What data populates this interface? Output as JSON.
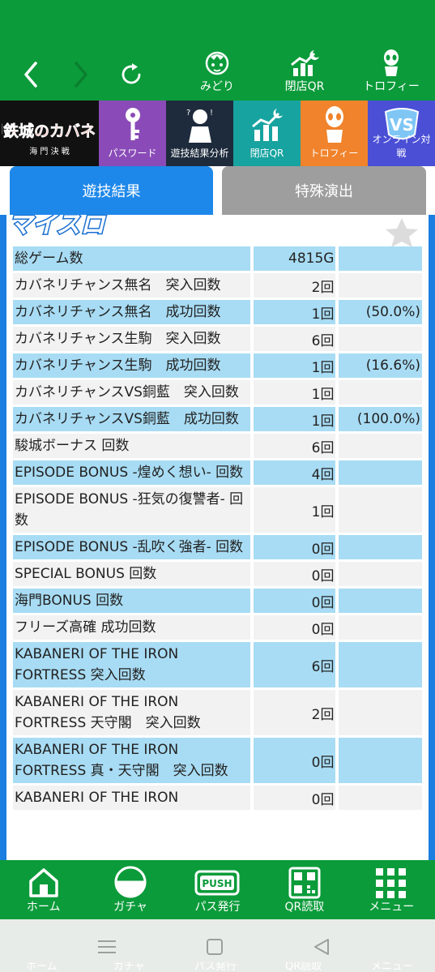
{
  "topnav": {
    "back_icon": "chevron-left-icon",
    "forward_icon": "chevron-right-icon",
    "reload_icon": "reload-icon",
    "items": [
      {
        "label": "みどり",
        "icon": "character-avatar-icon"
      },
      {
        "label": "閉店QR",
        "icon": "chart-moon-icon"
      },
      {
        "label": "トロフィー",
        "icon": "alien-trophy-icon"
      }
    ]
  },
  "banner": {
    "logo_text": "甲鉄城のカバネリ",
    "logo_sub": "海 門 決 戦",
    "tiles": [
      {
        "label": "パスワード",
        "color": "#8a4bb8"
      },
      {
        "label": "遊技結果分析",
        "color": "#1e2b3c"
      },
      {
        "label": "閉店QR",
        "color": "#17a3a0"
      },
      {
        "label": "トロフィー",
        "color": "#f0832b"
      },
      {
        "label": "オンライン対戦",
        "color": "#4a4fd6"
      }
    ]
  },
  "tabs": [
    {
      "label": "遊技結果",
      "active": true
    },
    {
      "label": "特殊演出",
      "active": false
    }
  ],
  "brand_logo": "マイスロ",
  "rows": [
    {
      "name": "総ゲーム数",
      "value": "4815G",
      "rate": ""
    },
    {
      "name": "カバネリチャンス無名　突入回数",
      "value": "2回",
      "rate": ""
    },
    {
      "name": "カバネリチャンス無名　成功回数",
      "value": "1回",
      "rate": "(50.0%)"
    },
    {
      "name": "カバネリチャンス生駒　突入回数",
      "value": "6回",
      "rate": ""
    },
    {
      "name": "カバネリチャンス生駒　成功回数",
      "value": "1回",
      "rate": "(16.6%)"
    },
    {
      "name": "カバネリチャンスVS銅藍　突入回数",
      "value": "1回",
      "rate": ""
    },
    {
      "name": "カバネリチャンスVS銅藍　成功回数",
      "value": "1回",
      "rate": "(100.0%)"
    },
    {
      "name": "駿城ボーナス 回数",
      "value": "6回",
      "rate": ""
    },
    {
      "name": "EPISODE BONUS -煌めく想い- 回数",
      "value": "4回",
      "rate": ""
    },
    {
      "name": "EPISODE BONUS -狂気の復讐者- 回数",
      "value": "1回",
      "rate": ""
    },
    {
      "name": "EPISODE BONUS -乱吹く強者- 回数",
      "value": "0回",
      "rate": ""
    },
    {
      "name": "SPECIAL BONUS 回数",
      "value": "0回",
      "rate": ""
    },
    {
      "name": "海門BONUS 回数",
      "value": "0回",
      "rate": ""
    },
    {
      "name": "フリーズ高確 成功回数",
      "value": "0回",
      "rate": ""
    },
    {
      "name": "KABANERI OF THE IRON FORTRESS 突入回数",
      "value": "6回",
      "rate": ""
    },
    {
      "name": "KABANERI OF THE IRON FORTRESS 天守閣　突入回数",
      "value": "2回",
      "rate": ""
    },
    {
      "name": "KABANERI OF THE IRON FORTRESS 真・天守閣　突入回数",
      "value": "0回",
      "rate": ""
    },
    {
      "name": "KABANERI OF THE IRON",
      "value": "0回",
      "rate": ""
    }
  ],
  "bottombar": [
    {
      "label": "ホーム",
      "icon": "home-icon"
    },
    {
      "label": "ガチャ",
      "icon": "gacha-ball-icon"
    },
    {
      "label": "パス発行",
      "icon": "push-button-icon"
    },
    {
      "label": "QR読取",
      "icon": "qr-code-icon"
    },
    {
      "label": "メニュー",
      "icon": "grid-menu-icon"
    }
  ],
  "push_text": "PUSH",
  "sysnav": {
    "recents_icon": "menu-lines-icon",
    "home_icon": "square-icon",
    "back_icon": "triangle-back-icon"
  },
  "sysnav_ghost": [
    "ホーム",
    "ガチャ",
    "パス発行",
    "QR読取",
    "メニュー"
  ]
}
